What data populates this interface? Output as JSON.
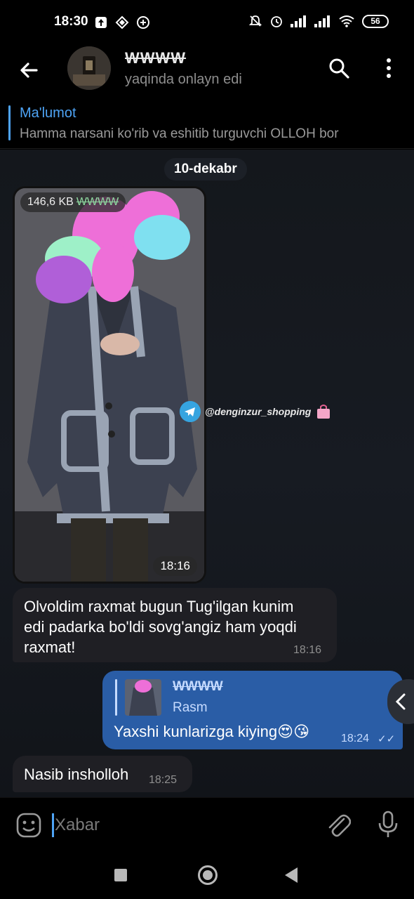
{
  "statusbar": {
    "time": "18:30",
    "battery": "56",
    "icons": [
      "upload-icon",
      "data-saver-icon",
      "add-circle-icon",
      "mute-bell-icon",
      "alarm-icon",
      "signal-icon",
      "signal-icon",
      "wifi-icon"
    ]
  },
  "header": {
    "name": "WWWW",
    "status": "yaqinda onlayn edi",
    "icons": [
      "back-arrow-icon",
      "search-icon",
      "more-vert-icon"
    ]
  },
  "pinned": {
    "title": "Ma'lumot",
    "text": "Hamma narsani ko'rib va eshitib turguvchi OLLOH bor"
  },
  "chat": {
    "date": "10-dekabr",
    "photo": {
      "size": "146,6 KB",
      "sender": "WWWW",
      "time": "18:16",
      "watermark": "@denginzur_shopping"
    },
    "messages": [
      {
        "direction": "in",
        "text_lines": [
          "Olvoldim raxmat bugun Tug'ilgan kunim",
          "edi padarka bo'ldi sovg'angiz ham yoqdi",
          "raxmat!"
        ],
        "time": "18:16"
      },
      {
        "direction": "out",
        "reply_name": "WWWW",
        "reply_text": "Rasm",
        "text": "Yaxshi kunlarizga kiying😍😘",
        "time": "18:24",
        "status": "read"
      },
      {
        "direction": "in",
        "text": "Nasib insholloh",
        "time": "18:25"
      }
    ]
  },
  "input": {
    "placeholder": "Xabar",
    "icons": [
      "emoji-icon",
      "attach-icon",
      "mic-icon"
    ]
  },
  "colors": {
    "accent": "#4ea4f6",
    "outgoing_bubble": "#2a5da6",
    "incoming_bubble": "#1f1f24"
  }
}
